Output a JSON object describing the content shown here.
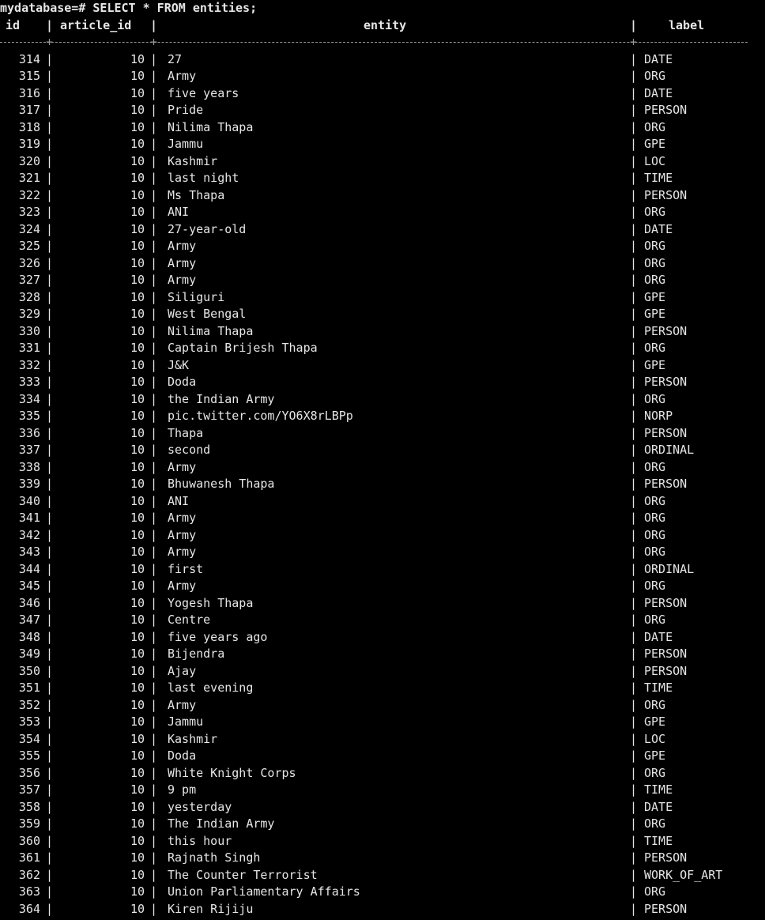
{
  "terminal": {
    "command": "mydatabase=# SELECT * FROM entities;",
    "columns": {
      "id": "id",
      "article_id": "article_id",
      "entity": "entity",
      "label": "label"
    },
    "pipe": "|",
    "plus": "+",
    "rows": [
      {
        "id": "314",
        "article_id": "10",
        "entity": "27",
        "label": "DATE"
      },
      {
        "id": "315",
        "article_id": "10",
        "entity": "Army",
        "label": "ORG"
      },
      {
        "id": "316",
        "article_id": "10",
        "entity": "five years",
        "label": "DATE"
      },
      {
        "id": "317",
        "article_id": "10",
        "entity": "Pride",
        "label": "PERSON"
      },
      {
        "id": "318",
        "article_id": "10",
        "entity": "Nilima Thapa",
        "label": "ORG"
      },
      {
        "id": "319",
        "article_id": "10",
        "entity": "Jammu",
        "label": "GPE"
      },
      {
        "id": "320",
        "article_id": "10",
        "entity": "Kashmir",
        "label": "LOC"
      },
      {
        "id": "321",
        "article_id": "10",
        "entity": "last night",
        "label": "TIME"
      },
      {
        "id": "322",
        "article_id": "10",
        "entity": "Ms Thapa",
        "label": "PERSON"
      },
      {
        "id": "323",
        "article_id": "10",
        "entity": "ANI",
        "label": "ORG"
      },
      {
        "id": "324",
        "article_id": "10",
        "entity": "27-year-old",
        "label": "DATE"
      },
      {
        "id": "325",
        "article_id": "10",
        "entity": "Army",
        "label": "ORG"
      },
      {
        "id": "326",
        "article_id": "10",
        "entity": "Army",
        "label": "ORG"
      },
      {
        "id": "327",
        "article_id": "10",
        "entity": "Army",
        "label": "ORG"
      },
      {
        "id": "328",
        "article_id": "10",
        "entity": "Siliguri",
        "label": "GPE"
      },
      {
        "id": "329",
        "article_id": "10",
        "entity": "West Bengal",
        "label": "GPE"
      },
      {
        "id": "330",
        "article_id": "10",
        "entity": "Nilima Thapa",
        "label": "PERSON"
      },
      {
        "id": "331",
        "article_id": "10",
        "entity": "Captain Brijesh Thapa",
        "label": "ORG"
      },
      {
        "id": "332",
        "article_id": "10",
        "entity": "J&K",
        "label": "GPE"
      },
      {
        "id": "333",
        "article_id": "10",
        "entity": "Doda",
        "label": "PERSON"
      },
      {
        "id": "334",
        "article_id": "10",
        "entity": "the Indian Army",
        "label": "ORG"
      },
      {
        "id": "335",
        "article_id": "10",
        "entity": "pic.twitter.com/YO6X8rLBPp",
        "label": "NORP"
      },
      {
        "id": "336",
        "article_id": "10",
        "entity": "Thapa",
        "label": "PERSON"
      },
      {
        "id": "337",
        "article_id": "10",
        "entity": "second",
        "label": "ORDINAL"
      },
      {
        "id": "338",
        "article_id": "10",
        "entity": "Army",
        "label": "ORG"
      },
      {
        "id": "339",
        "article_id": "10",
        "entity": "Bhuwanesh Thapa",
        "label": "PERSON"
      },
      {
        "id": "340",
        "article_id": "10",
        "entity": "ANI",
        "label": "ORG"
      },
      {
        "id": "341",
        "article_id": "10",
        "entity": "Army",
        "label": "ORG"
      },
      {
        "id": "342",
        "article_id": "10",
        "entity": "Army",
        "label": "ORG"
      },
      {
        "id": "343",
        "article_id": "10",
        "entity": "Army",
        "label": "ORG"
      },
      {
        "id": "344",
        "article_id": "10",
        "entity": "first",
        "label": "ORDINAL"
      },
      {
        "id": "345",
        "article_id": "10",
        "entity": "Army",
        "label": "ORG"
      },
      {
        "id": "346",
        "article_id": "10",
        "entity": "Yogesh Thapa",
        "label": "PERSON"
      },
      {
        "id": "347",
        "article_id": "10",
        "entity": "Centre",
        "label": "ORG"
      },
      {
        "id": "348",
        "article_id": "10",
        "entity": "five years ago",
        "label": "DATE"
      },
      {
        "id": "349",
        "article_id": "10",
        "entity": "Bijendra",
        "label": "PERSON"
      },
      {
        "id": "350",
        "article_id": "10",
        "entity": "Ajay",
        "label": "PERSON"
      },
      {
        "id": "351",
        "article_id": "10",
        "entity": "last evening",
        "label": "TIME"
      },
      {
        "id": "352",
        "article_id": "10",
        "entity": "Army",
        "label": "ORG"
      },
      {
        "id": "353",
        "article_id": "10",
        "entity": "Jammu",
        "label": "GPE"
      },
      {
        "id": "354",
        "article_id": "10",
        "entity": "Kashmir",
        "label": "LOC"
      },
      {
        "id": "355",
        "article_id": "10",
        "entity": "Doda",
        "label": "GPE"
      },
      {
        "id": "356",
        "article_id": "10",
        "entity": "White Knight Corps",
        "label": "ORG"
      },
      {
        "id": "357",
        "article_id": "10",
        "entity": "9 pm",
        "label": "TIME"
      },
      {
        "id": "358",
        "article_id": "10",
        "entity": "yesterday",
        "label": "DATE"
      },
      {
        "id": "359",
        "article_id": "10",
        "entity": "The Indian Army",
        "label": "ORG"
      },
      {
        "id": "360",
        "article_id": "10",
        "entity": "this hour",
        "label": "TIME"
      },
      {
        "id": "361",
        "article_id": "10",
        "entity": "Rajnath Singh",
        "label": "PERSON"
      },
      {
        "id": "362",
        "article_id": "10",
        "entity": "The Counter Terrorist",
        "label": "WORK_OF_ART"
      },
      {
        "id": "363",
        "article_id": "10",
        "entity": "Union Parliamentary Affairs",
        "label": "ORG"
      },
      {
        "id": "364",
        "article_id": "10",
        "entity": "Kiren Rijiju",
        "label": "PERSON"
      }
    ]
  }
}
